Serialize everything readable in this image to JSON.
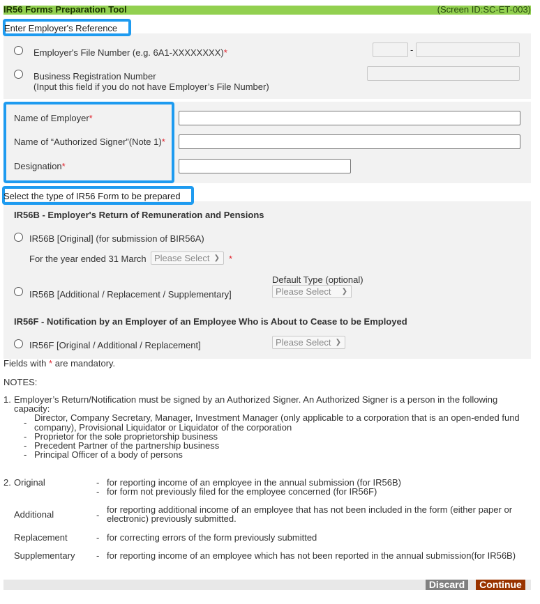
{
  "header": {
    "title": "IR56 Forms Preparation Tool",
    "screen_id": "(Screen ID:SC-ET-003)",
    "bar_color": "#92d050"
  },
  "employer_reference": {
    "section_label": "Enter Employer's Reference",
    "file_number": {
      "label": "Employer's File Number (e.g. 6A1-XXXXXXXX)",
      "required_mark": "*",
      "prefix_value": "",
      "separator": "-",
      "suffix_value": ""
    },
    "brn": {
      "label": "Business Registration Number",
      "sublabel": "(Input this field if you do not have Employer’s File Number)",
      "value": ""
    }
  },
  "employer_details": {
    "name_of_employer": {
      "label": "Name of Employer",
      "required_mark": "*",
      "value": ""
    },
    "authorized_signer": {
      "label": "Name of “Authorized Signer”(Note 1)",
      "required_mark": "*",
      "value": ""
    },
    "designation": {
      "label": "Designation",
      "required_mark": "*",
      "value": ""
    }
  },
  "form_type": {
    "section_label": "Select the type of IR56 Form to be prepared",
    "ir56b": {
      "heading": "IR56B - Employer's Return of Remuneration and Pensions",
      "original_label": "IR56B [Original] (for submission of BIR56A)",
      "year_label": "For the year ended 31 March",
      "year_select": "Please Select",
      "year_required_mark": "*",
      "additional_label": "IR56B [Additional / Replacement / Supplementary]",
      "default_type_label": "Default Type (optional)",
      "default_type_select": "Please Select"
    },
    "ir56f": {
      "heading": "IR56F - Notification by an Employer of an Employee Who is About to Cease to be Employed",
      "option_label": "IR56F [Original / Additional / Replacement]",
      "select": "Please Select"
    }
  },
  "mandatory_note": {
    "prefix": "Fields with ",
    "mark": "*",
    "suffix": " are mandatory."
  },
  "notes": {
    "title": "NOTES:",
    "note1": {
      "number": "1.",
      "text_line1": "Employer’s Return/Notification must be signed by an Authorized Signer. An Authorized Signer is a person in the following",
      "text_line2": "capacity:",
      "bullets": [
        {
          "line1": "Director, Company Secretary, Manager, Investment Manager (only applicable to a corporation that is an open-ended fund",
          "line2": "company), Provisional Liquidator or Liquidator of the corporation"
        },
        {
          "line1": "Proprietor for the sole proprietorship business"
        },
        {
          "line1": "Precedent Partner of the partnership business"
        },
        {
          "line1": "Principal Officer of a body of persons"
        }
      ]
    },
    "note2": {
      "number": "2.",
      "items": [
        {
          "term": "Original",
          "desc": [
            "for reporting income of an employee in the annual submission (for IR56B)",
            "for form not previously filed for the employee concerned (for IR56F)"
          ]
        },
        {
          "term": "Additional",
          "desc": [
            "for reporting additional income of an employee that has not been included in the form (either paper or",
            "electronic) previously submitted."
          ]
        },
        {
          "term": "Replacement",
          "desc": [
            "for correcting errors of the form previously submitted"
          ]
        },
        {
          "term": "Supplementary",
          "desc": [
            "for reporting income of an employee which has not been reported in the annual submission(for IR56B)"
          ]
        }
      ]
    }
  },
  "actions": {
    "discard_label": "Discard",
    "continue_label": "Continue",
    "discard_color": "#808080",
    "continue_color": "#993300"
  }
}
